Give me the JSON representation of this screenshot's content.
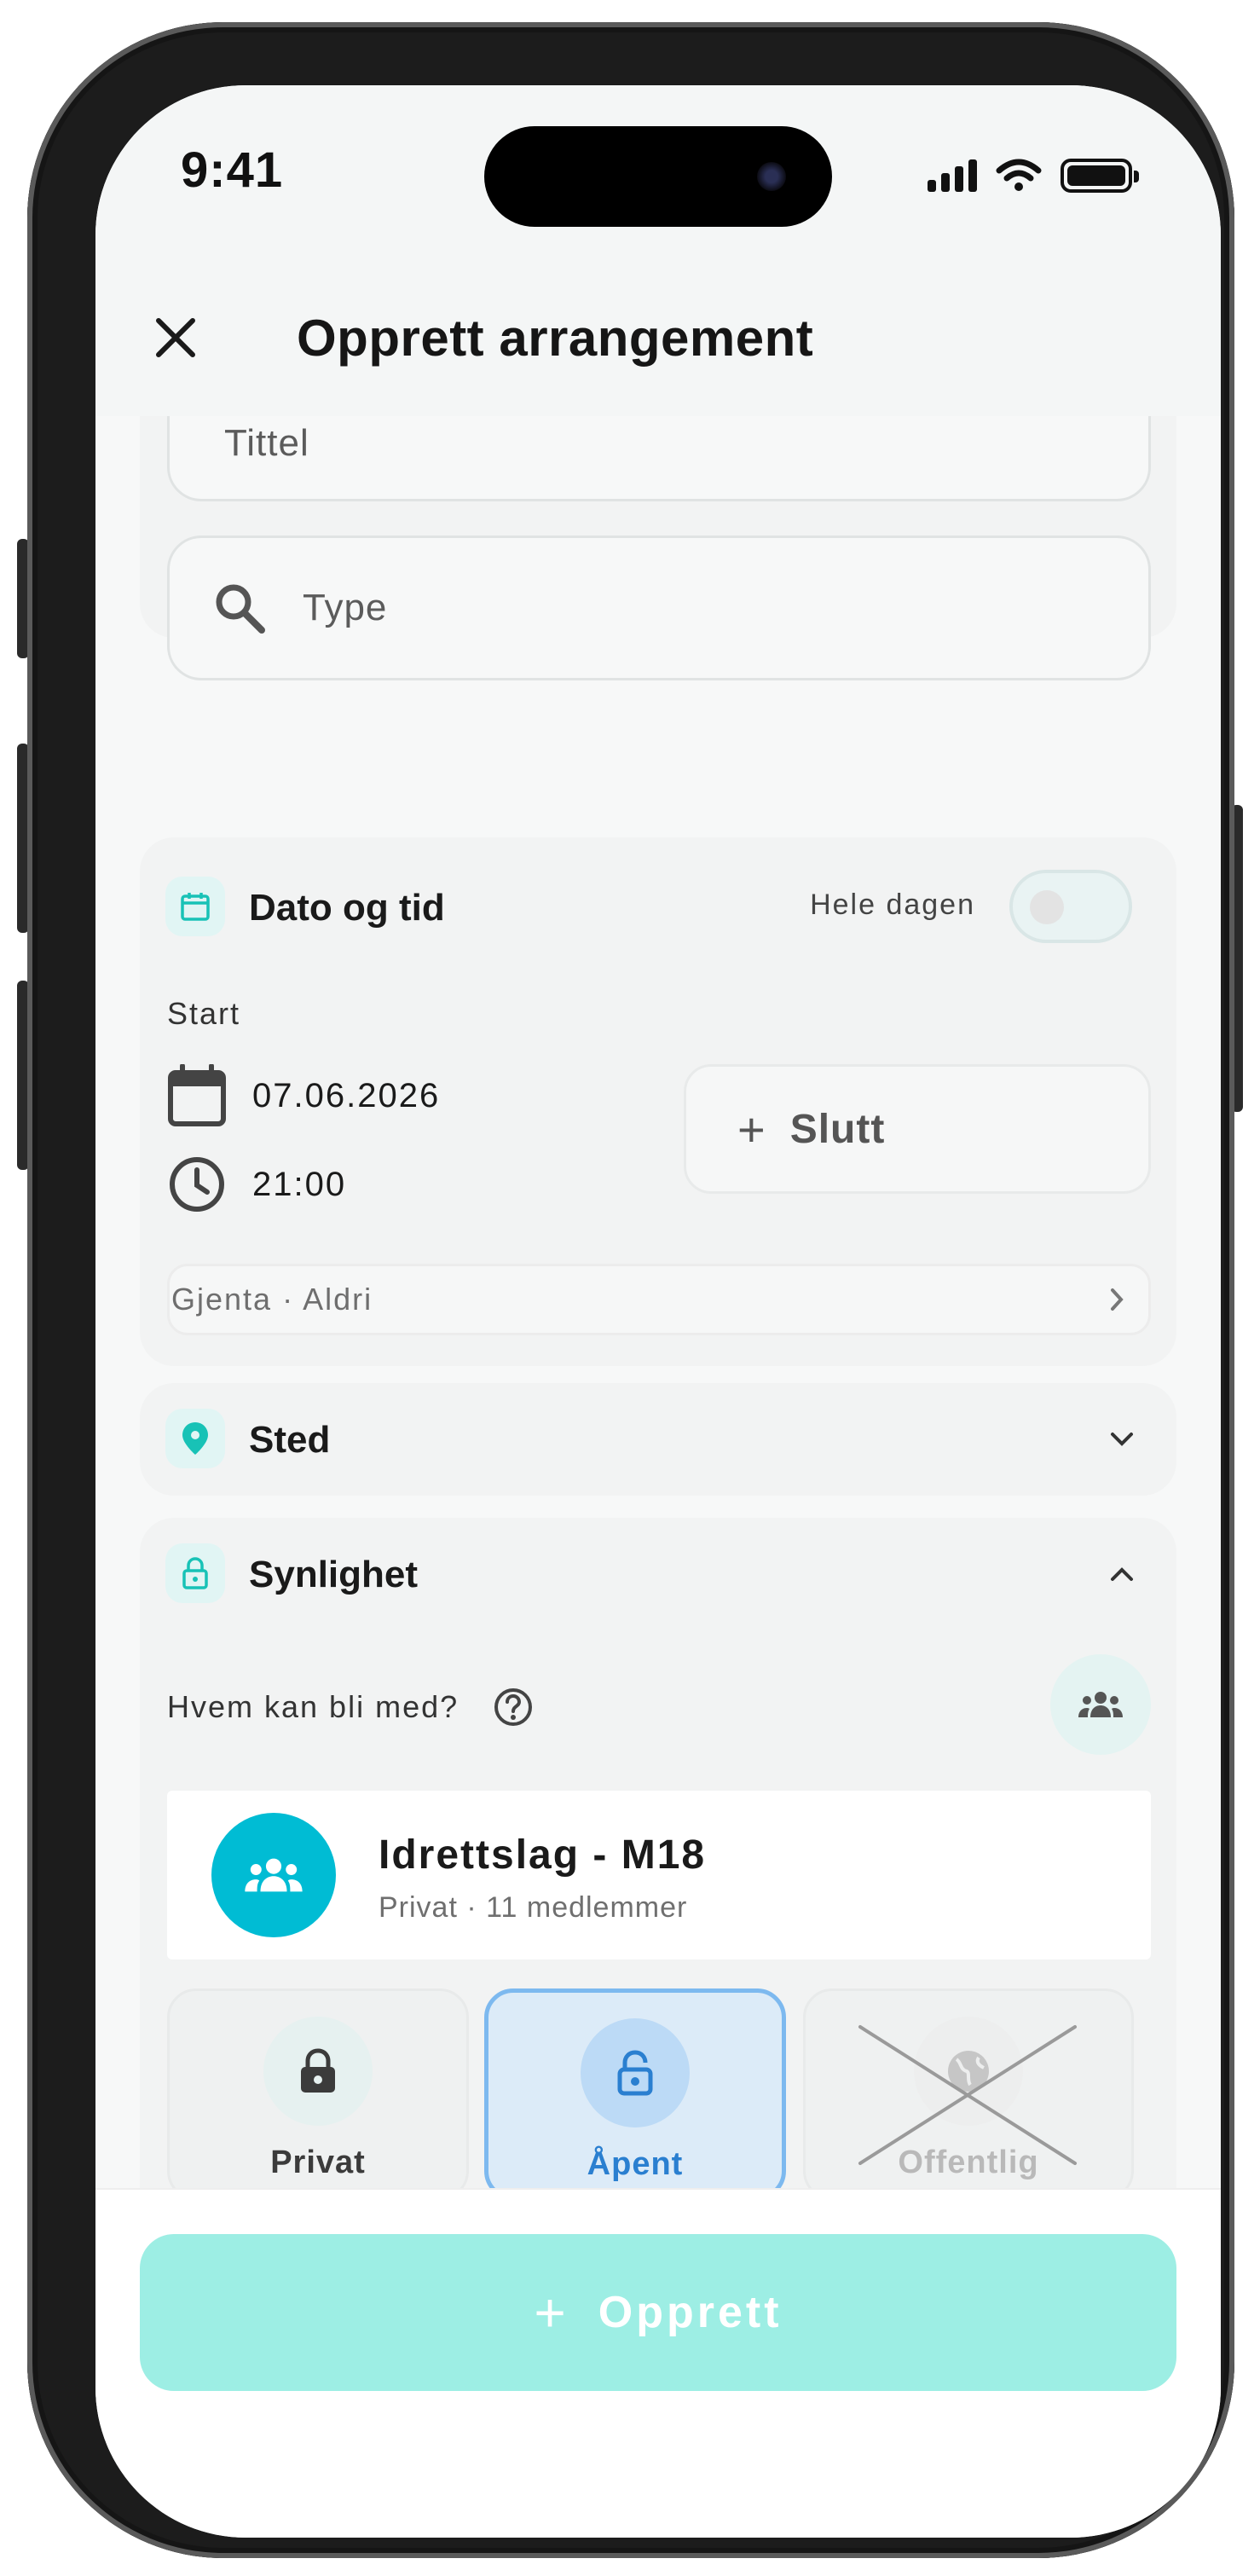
{
  "status_bar": {
    "time": "9:41"
  },
  "header": {
    "title": "Opprett arrangement"
  },
  "basic": {
    "title_placeholder": "Tittel",
    "type_placeholder": "Type"
  },
  "date_time": {
    "section_title": "Dato og tid",
    "all_day_label": "Hele dagen",
    "all_day_on": false,
    "start_label": "Start",
    "start_date": "07.06.2026",
    "start_time": "21:00",
    "end_button_label": "Slutt",
    "repeat_text": "Gjenta · Aldri"
  },
  "location": {
    "section_title": "Sted"
  },
  "visibility": {
    "section_title": "Synlighet",
    "who_label": "Hvem kan bli med?",
    "group": {
      "name": "Idrettslag - M18",
      "meta": "Privat · 11 medlemmer"
    },
    "options": [
      {
        "label": "Privat",
        "selected": false,
        "disabled": false,
        "icon": "lock-icon"
      },
      {
        "label": "Åpent",
        "selected": true,
        "disabled": false,
        "icon": "lock-open-icon"
      },
      {
        "label": "Offentlig",
        "selected": false,
        "disabled": true,
        "icon": "globe-icon"
      }
    ]
  },
  "footer": {
    "create_label": "Opprett"
  },
  "colors": {
    "accent": "#00bcd4",
    "create_button": "#9deee4",
    "selected_option_border": "#7db9ef",
    "selected_option_bg": "#dcebf8"
  }
}
